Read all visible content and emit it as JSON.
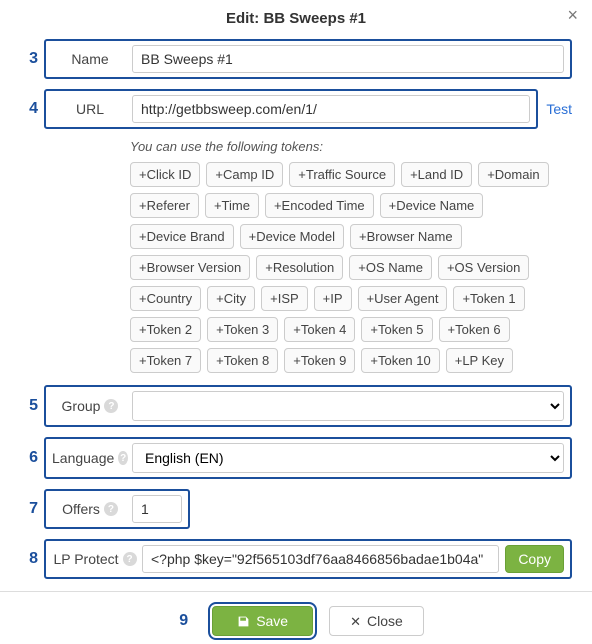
{
  "dialog": {
    "title": "Edit: BB Sweeps #1",
    "close_x": "×"
  },
  "annotations": {
    "n3": "3",
    "n4": "4",
    "n5": "5",
    "n6": "6",
    "n7": "7",
    "n8": "8",
    "n9": "9"
  },
  "fields": {
    "name": {
      "label": "Name",
      "value": "BB Sweeps #1"
    },
    "url": {
      "label": "URL",
      "value": "http://getbbsweep.com/en/1/",
      "test": "Test"
    },
    "tokens_hint": "You can use the following tokens:",
    "tokens": [
      "+Click ID",
      "+Camp ID",
      "+Traffic Source",
      "+Land ID",
      "+Domain",
      "+Referer",
      "+Time",
      "+Encoded Time",
      "+Device Name",
      "+Device Brand",
      "+Device Model",
      "+Browser Name",
      "+Browser Version",
      "+Resolution",
      "+OS Name",
      "+OS Version",
      "+Country",
      "+City",
      "+ISP",
      "+IP",
      "+User Agent",
      "+Token 1",
      "+Token 2",
      "+Token 3",
      "+Token 4",
      "+Token 5",
      "+Token 6",
      "+Token 7",
      "+Token 8",
      "+Token 9",
      "+Token 10",
      "+LP Key"
    ],
    "group": {
      "label": "Group",
      "value": ""
    },
    "language": {
      "label": "Language",
      "value": "English (EN)"
    },
    "offers": {
      "label": "Offers",
      "value": "1"
    },
    "lpprotect": {
      "label": "LP Protect",
      "value": "<?php $key=\"92f565103df76aa8466856badae1b04a\"",
      "copy": "Copy"
    }
  },
  "footer": {
    "save": "Save",
    "close": "Close"
  }
}
